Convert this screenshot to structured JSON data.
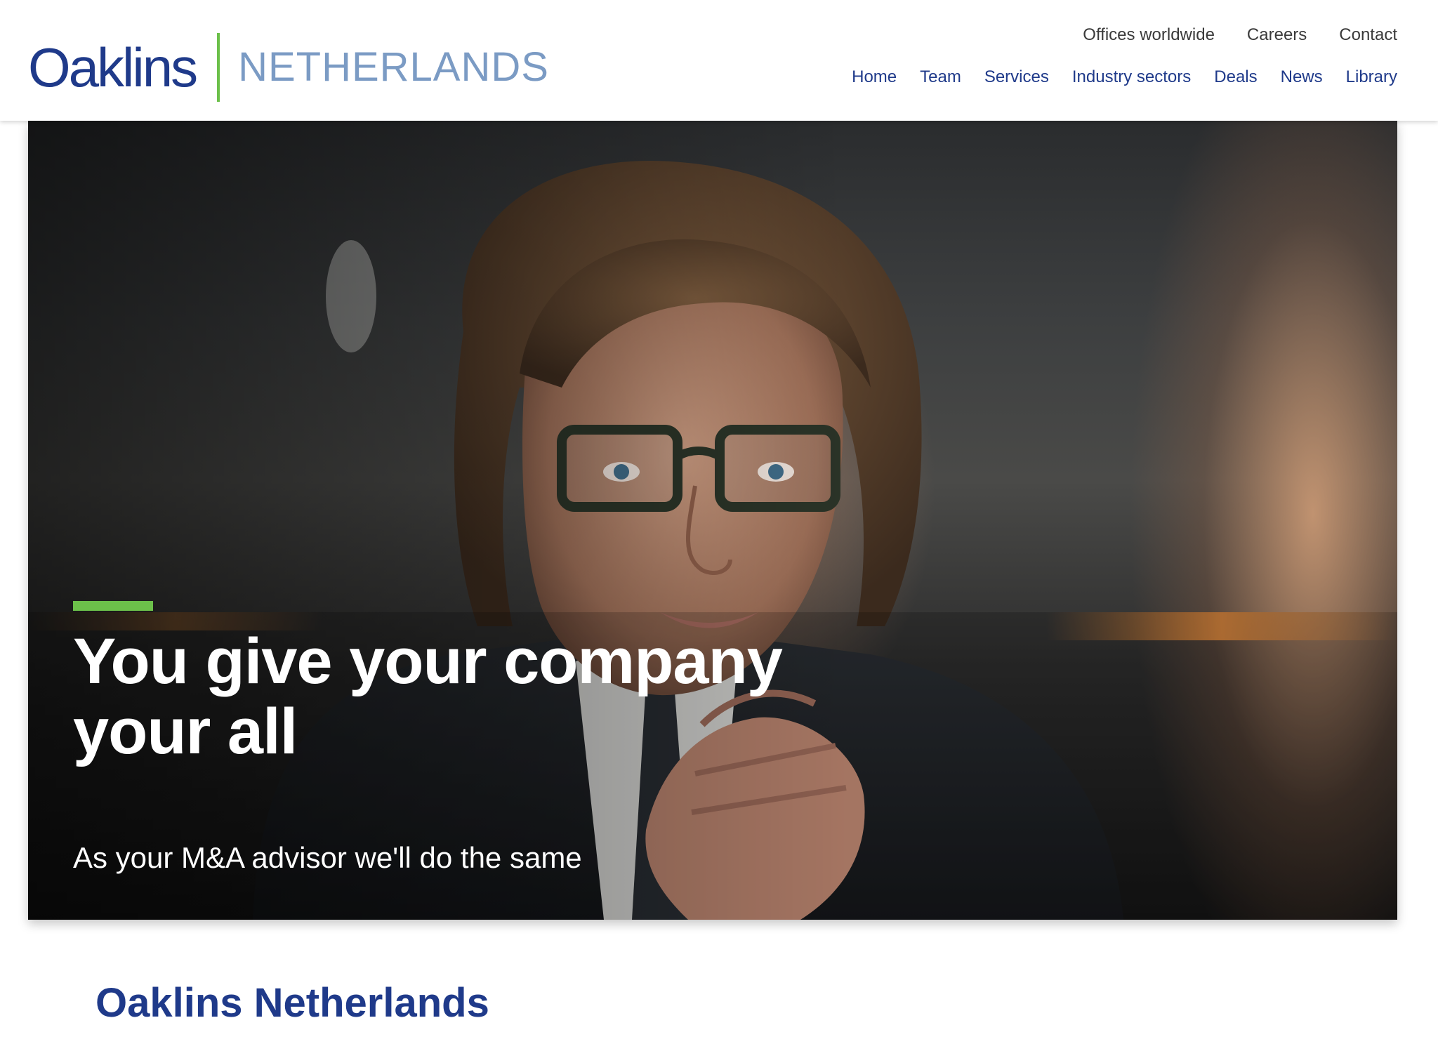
{
  "brand": {
    "name": "Oaklins",
    "country": "NETHERLANDS",
    "colors": {
      "navy": "#1f3a8a",
      "green": "#6cc04a",
      "light_blue": "#7b9bc4"
    }
  },
  "utility_nav": [
    {
      "label": "Offices worldwide"
    },
    {
      "label": "Careers"
    },
    {
      "label": "Contact"
    }
  ],
  "main_nav": [
    {
      "label": "Home"
    },
    {
      "label": "Team"
    },
    {
      "label": "Services"
    },
    {
      "label": "Industry sectors"
    },
    {
      "label": "Deals"
    },
    {
      "label": "News"
    },
    {
      "label": "Library"
    }
  ],
  "hero": {
    "title_line1": "You give your company",
    "title_line2": "your all",
    "subtitle": "As your M&A advisor we'll do the same"
  },
  "section": {
    "title": "Oaklins Netherlands"
  }
}
